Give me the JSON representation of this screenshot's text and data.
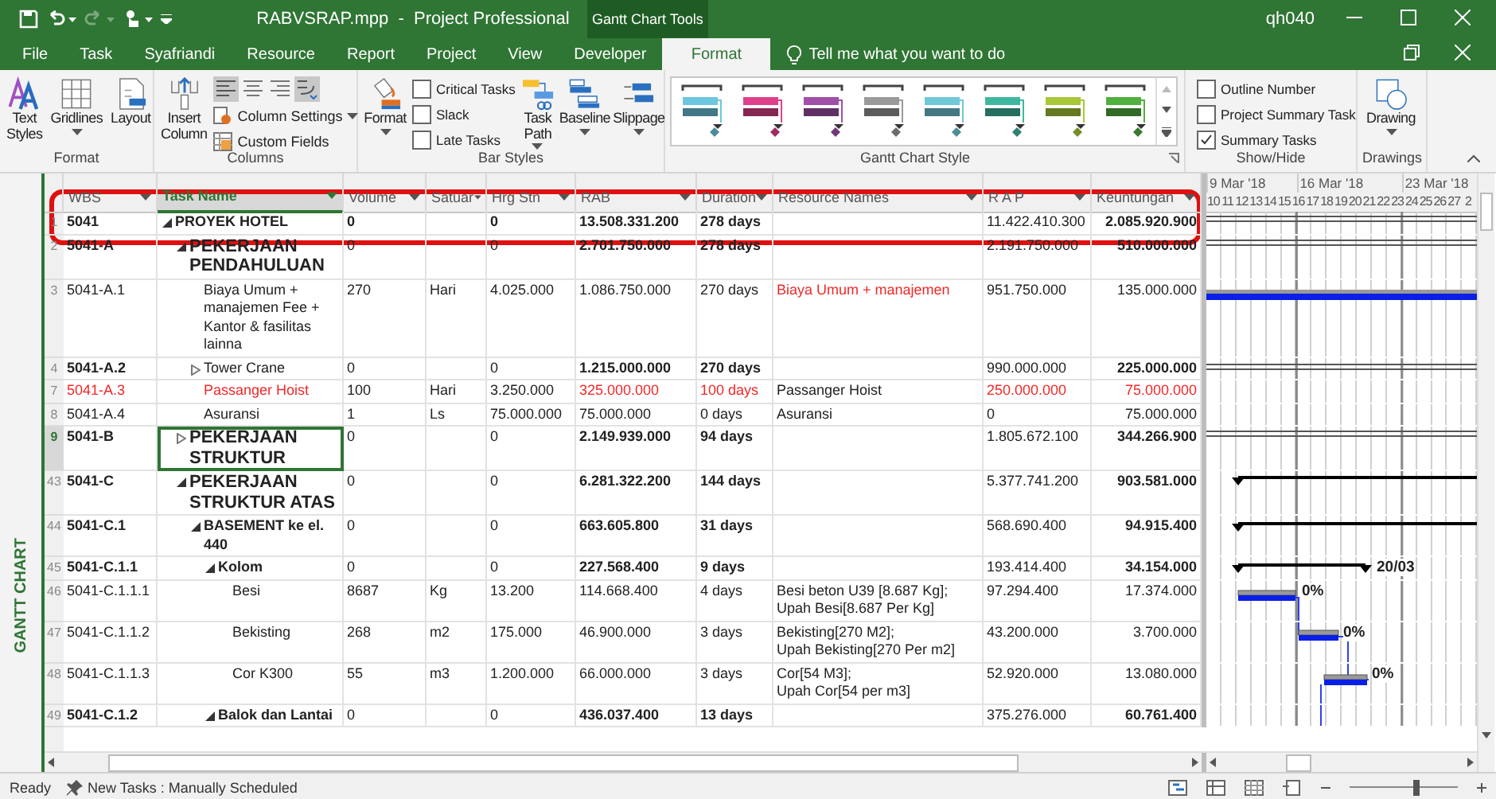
{
  "window": {
    "title": "RABVSRAP.mpp  -  Project Professional",
    "context_tab": "Gantt Chart Tools",
    "user": "qh040"
  },
  "tabs": [
    {
      "label": "File",
      "selected": false
    },
    {
      "label": "Task",
      "selected": false
    },
    {
      "label": "Syafriandi",
      "selected": false
    },
    {
      "label": "Resource",
      "selected": false
    },
    {
      "label": "Report",
      "selected": false
    },
    {
      "label": "Project",
      "selected": false
    },
    {
      "label": "View",
      "selected": false
    },
    {
      "label": "Developer",
      "selected": false
    },
    {
      "label": "Format",
      "selected": true
    }
  ],
  "tell_me": {
    "placeholder": "Tell me what you want to do"
  },
  "ribbon": {
    "format": {
      "label": "Format",
      "buttons": [
        {
          "label": "Text Styles",
          "kind": "text-styles",
          "dropdown": false
        },
        {
          "label": "Gridlines",
          "kind": "gridlines",
          "dropdown": true
        },
        {
          "label": "Layout",
          "kind": "layout",
          "dropdown": false
        }
      ]
    },
    "columns": {
      "label": "Columns",
      "insert": "Insert Column",
      "align": [
        {
          "kind": "left",
          "selected": true
        },
        {
          "kind": "center",
          "selected": false
        },
        {
          "kind": "right",
          "selected": false
        },
        {
          "kind": "wrap",
          "selected": true
        }
      ],
      "settings": "Column Settings",
      "custom": "Custom Fields"
    },
    "bar_styles": {
      "label": "Bar Styles",
      "format": "Format",
      "checks": [
        {
          "label": "Critical Tasks",
          "checked": false
        },
        {
          "label": "Slack",
          "checked": false
        },
        {
          "label": "Late Tasks",
          "checked": false
        }
      ],
      "buttons": [
        {
          "label": "Task Path",
          "kind": "task-path",
          "dropdown": true
        },
        {
          "label": "Baseline",
          "kind": "baseline",
          "dropdown": true
        },
        {
          "label": "Slippage",
          "kind": "slippage",
          "dropdown": true
        }
      ]
    },
    "gantt_style": {
      "label": "Gantt Chart Style",
      "styles": [
        {
          "color": "#6cc6e0"
        },
        {
          "color": "#e0408a"
        },
        {
          "color": "#a050a8"
        },
        {
          "color": "#9a9a9a"
        },
        {
          "color": "#70c8d8"
        },
        {
          "color": "#40b8a0"
        },
        {
          "color": "#a8c838"
        },
        {
          "color": "#50b040"
        }
      ]
    },
    "show_hide": {
      "label": "Show/Hide",
      "checks": [
        {
          "label": "Outline Number",
          "checked": false
        },
        {
          "label": "Project Summary Task",
          "checked": false
        },
        {
          "label": "Summary Tasks",
          "checked": true
        }
      ]
    },
    "drawings": {
      "label": "Drawings",
      "button": "Drawing"
    }
  },
  "view": {
    "label": "GANTT CHART"
  },
  "table": {
    "columns": [
      {
        "label": "WBS",
        "selected": false
      },
      {
        "label": "Task Name",
        "selected": true
      },
      {
        "label": "Volume",
        "selected": false
      },
      {
        "label": "Satuar",
        "selected": false
      },
      {
        "label": "Hrg Stn",
        "selected": false
      },
      {
        "label": "RAB",
        "selected": false
      },
      {
        "label": "Duration",
        "selected": false
      },
      {
        "label": "Resource Names",
        "selected": false
      },
      {
        "label": "R A P",
        "selected": false
      },
      {
        "label": "Keuntungan",
        "selected": false
      }
    ],
    "rows": [
      {
        "id": "1",
        "wbs": "5041",
        "name": "PROYEK HOTEL",
        "kind": "project",
        "expanded": true,
        "selected": false,
        "critical": false,
        "volume": "0",
        "hrg_stn": "0",
        "rab": "13.508.331.200",
        "duration": "278 days",
        "rap": "11.422.410.300",
        "keuntungan": "2.085.920.900",
        "children": [
          {
            "id": "2",
            "wbs": "5041-A",
            "name": "PEKERJAAN PENDAHULUAN",
            "kind": "phase",
            "expanded": true,
            "selected": false,
            "critical": false,
            "volume": "0",
            "hrg_stn": "0",
            "rab": "2.701.750.000",
            "duration": "278 days",
            "rap": "2.191.750.000",
            "keuntungan": "510.000.000",
            "children": [
              {
                "id": "3",
                "wbs": "5041-A.1",
                "name": "Biaya Umum + manajemen Fee + Kantor & fasilitas lainna",
                "kind": "task",
                "selected": false,
                "critical": false,
                "volume": "270",
                "satuan": "Hari",
                "hrg_stn": "4.025.000",
                "rab": "1.086.750.000",
                "duration": "270 days",
                "resources": [
                  "Biaya Umum + manajemen"
                ],
                "overallocated": true,
                "rap": "951.750.000",
                "keuntungan": "135.000.000"
              },
              {
                "id": "4",
                "wbs": "5041-A.2",
                "name": "Tower Crane",
                "kind": "summary",
                "expanded": false,
                "selected": false,
                "critical": false,
                "volume": "0",
                "hrg_stn": "0",
                "rab": "1.215.000.000",
                "duration": "270 days",
                "rap": "990.000.000",
                "keuntungan": "225.000.000"
              },
              {
                "id": "7",
                "wbs": "5041-A.3",
                "name": "Passanger Hoist",
                "kind": "task",
                "selected": false,
                "critical": true,
                "volume": "100",
                "satuan": "Hari",
                "hrg_stn": "3.250.000",
                "rab": "325.000.000",
                "duration": "100 days",
                "resources": [
                  "Passanger Hoist"
                ],
                "overallocated": false,
                "rap": "250.000.000",
                "keuntungan": "75.000.000"
              },
              {
                "id": "8",
                "wbs": "5041-A.4",
                "name": "Asuransi",
                "kind": "task",
                "selected": false,
                "critical": false,
                "volume": "1",
                "satuan": "Ls",
                "hrg_stn": "75.000.000",
                "rab": "75.000.000",
                "duration": "0 days",
                "resources": [
                  "Asuransi"
                ],
                "overallocated": false,
                "rap": "0",
                "keuntungan": "75.000.000"
              }
            ]
          },
          {
            "id": "9",
            "wbs": "5041-B",
            "name": "PEKERJAAN STRUKTUR",
            "kind": "phase",
            "expanded": false,
            "selected": true,
            "critical": false,
            "volume": "0",
            "hrg_stn": "0",
            "rab": "2.149.939.000",
            "duration": "94 days",
            "rap": "1.805.672.100",
            "keuntungan": "344.266.900"
          },
          {
            "id": "43",
            "wbs": "5041-C",
            "name": "PEKERJAAN STRUKTUR ATAS",
            "kind": "phase",
            "expanded": true,
            "selected": false,
            "critical": false,
            "volume": "0",
            "hrg_stn": "0",
            "rab": "6.281.322.200",
            "duration": "144 days",
            "rap": "5.377.741.200",
            "keuntungan": "903.581.000",
            "children": [
              {
                "id": "44",
                "wbs": "5041-C.1",
                "name": "BASEMENT ke el. 440",
                "kind": "group",
                "expanded": true,
                "selected": false,
                "critical": false,
                "volume": "0",
                "hrg_stn": "0",
                "rab": "663.605.800",
                "duration": "31 days",
                "rap": "568.690.400",
                "keuntungan": "94.915.400",
                "children": [
                  {
                    "id": "45",
                    "wbs": "5041-C.1.1",
                    "name": "Kolom",
                    "kind": "group",
                    "expanded": true,
                    "selected": false,
                    "critical": false,
                    "volume": "0",
                    "hrg_stn": "0",
                    "rab": "227.568.400",
                    "duration": "9 days",
                    "rap": "193.414.400",
                    "keuntungan": "34.154.000",
                    "bar_label": "20/03",
                    "children": [
                      {
                        "id": "46",
                        "wbs": "5041-C.1.1.1",
                        "name": "Besi",
                        "kind": "task",
                        "selected": false,
                        "critical": false,
                        "volume": "8687",
                        "satuan": "Kg",
                        "hrg_stn": "13.200",
                        "rab": "114.668.400",
                        "duration": "4 days",
                        "resources": [
                          "Besi beton U39 [8.687 Kg];",
                          "Upah Besi[8.687 Per Kg]"
                        ],
                        "overallocated": false,
                        "rap": "97.294.400",
                        "keuntungan": "17.374.000",
                        "bar_label": "0%"
                      },
                      {
                        "id": "47",
                        "wbs": "5041-C.1.1.2",
                        "name": "Bekisting",
                        "kind": "task",
                        "selected": false,
                        "critical": false,
                        "volume": "268",
                        "satuan": "m2",
                        "hrg_stn": "175.000",
                        "rab": "46.900.000",
                        "duration": "3 days",
                        "resources": [
                          "Bekisting[270 M2];",
                          "Upah Bekisting[270 Per m2]"
                        ],
                        "overallocated": false,
                        "rap": "43.200.000",
                        "keuntungan": "3.700.000",
                        "bar_label": "0%"
                      },
                      {
                        "id": "48",
                        "wbs": "5041-C.1.1.3",
                        "name": "Cor K300",
                        "kind": "task",
                        "selected": false,
                        "critical": false,
                        "volume": "55",
                        "satuan": "m3",
                        "hrg_stn": "1.200.000",
                        "rab": "66.000.000",
                        "duration": "3 days",
                        "resources": [
                          "Cor[54 M3];",
                          "Upah Cor[54 per m3]"
                        ],
                        "overallocated": false,
                        "rap": "52.920.000",
                        "keuntungan": "13.080.000",
                        "bar_label": "0%"
                      }
                    ]
                  },
                  {
                    "id": "49",
                    "wbs": "5041-C.1.2",
                    "name": "Balok dan Lantai",
                    "kind": "group",
                    "expanded": true,
                    "selected": false,
                    "critical": false,
                    "volume": "0",
                    "hrg_stn": "0",
                    "rab": "436.037.400",
                    "duration": "13 days",
                    "rap": "375.276.000",
                    "keuntungan": "60.761.400"
                  }
                ]
              }
            ]
          }
        ]
      }
    ]
  },
  "gantt": {
    "weeks": [
      "9 Mar '18",
      "16 Mar '18",
      "23 Mar '18"
    ],
    "days": [
      "10",
      "11",
      "12",
      "13",
      "14",
      "15",
      "16",
      "17",
      "18",
      "19",
      "20",
      "21",
      "22",
      "23",
      "24",
      "25",
      "26",
      "27",
      "2"
    ]
  },
  "status_bar": {
    "state": "Ready",
    "new_tasks": "New Tasks : Manually Scheduled",
    "zoom": {
      "level": 0.62
    }
  }
}
